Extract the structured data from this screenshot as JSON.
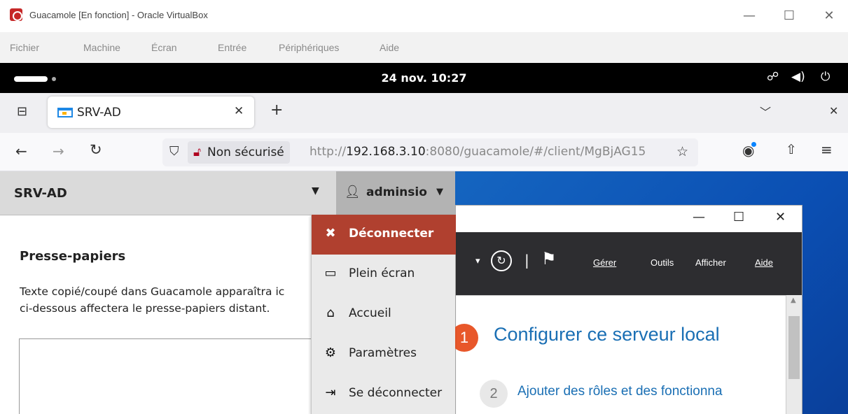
{
  "vbox": {
    "title": "Guacamole [En fonction] - Oracle VirtualBox",
    "menu": [
      "Fichier",
      "Machine",
      "Écran",
      "Entrée",
      "Périphériques",
      "Aide"
    ]
  },
  "gnome": {
    "clock": "24 nov. 10:27"
  },
  "browser": {
    "tab_title": "SRV-AD",
    "security_label": "Non sécurisé",
    "url_prefix": "http://",
    "url_host": "192.168.3.10",
    "url_rest": ":8080/guacamole/#/client/MgBjAG15"
  },
  "guac": {
    "connection_name": "SRV-AD",
    "username": "adminsio",
    "clipboard_title": "Presse-papiers",
    "clipboard_desc_line1": "Texte copié/coupé dans Guacamole apparaîtra ic",
    "clipboard_desc_line2": "ci-dessous affectera le presse-papiers distant.",
    "menu": [
      {
        "label": "Déconnecter",
        "icon": "close-icon",
        "active": true
      },
      {
        "label": "Plein écran",
        "icon": "monitor-icon",
        "active": false
      },
      {
        "label": "Accueil",
        "icon": "home-icon",
        "active": false
      },
      {
        "label": "Paramètres",
        "icon": "gear-icon",
        "active": false
      },
      {
        "label": "Se déconnecter",
        "icon": "logout-icon",
        "active": false
      }
    ]
  },
  "remote": {
    "menus": [
      "Gérer",
      "Outils",
      "Afficher",
      "Aide"
    ],
    "step1_number": "1",
    "step1_text": "Configurer ce serveur local",
    "step2_number": "2",
    "step2_text": "Ajouter des rôles et des fonctionna"
  },
  "colors": {
    "guac_active_item": "#b0402f",
    "desktop_blue": "#0b4fb3",
    "step1_orange": "#e8572a",
    "link_blue": "#1a6fb4"
  }
}
